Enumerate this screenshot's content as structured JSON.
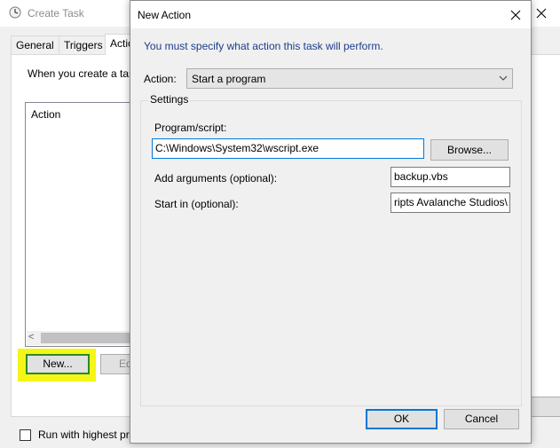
{
  "background_window": {
    "title": "Create Task",
    "tabs": [
      "General",
      "Triggers",
      "Actio"
    ],
    "description": "When you create a tas",
    "action_list_header": "Action",
    "new_button": "New...",
    "edit_button": "Ed",
    "run_highest_label": "Run with highest pr",
    "highlight_color": "#f5f518"
  },
  "dialog": {
    "title": "New Action",
    "instruction": "You must specify what action this task will perform.",
    "action_label": "Action:",
    "action_value": "Start a program",
    "settings_label": "Settings",
    "program_label": "Program/script:",
    "program_value": "C:\\Windows\\System32\\wscript.exe",
    "browse_button": "Browse...",
    "args_label": "Add arguments (optional):",
    "args_value": "backup.vbs",
    "start_label": "Start in (optional):",
    "start_value": "ripts Avalanche Studios\\",
    "ok_button": "OK",
    "cancel_button": "Cancel",
    "instruction_color": "#1b3c8e",
    "focus_color": "#0078d7"
  }
}
